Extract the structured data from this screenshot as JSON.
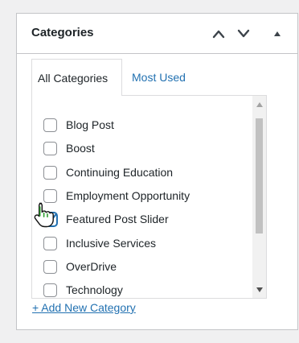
{
  "panel": {
    "title": "Categories",
    "move_up_icon": "chevron-up-icon",
    "move_down_icon": "chevron-down-icon",
    "toggle_icon": "triangle-up-icon"
  },
  "tabs": [
    {
      "label": "All Categories",
      "active": true
    },
    {
      "label": "Most Used",
      "active": false
    }
  ],
  "categories": [
    {
      "label": "Blog Post",
      "checked": false
    },
    {
      "label": "Boost",
      "checked": false
    },
    {
      "label": "Continuing Education",
      "checked": false
    },
    {
      "label": "Employment Opportunity",
      "checked": false
    },
    {
      "label": "Featured Post Slider",
      "checked": true
    },
    {
      "label": "Inclusive Services",
      "checked": false
    },
    {
      "label": "OverDrive",
      "checked": false
    },
    {
      "label": "Technology",
      "checked": false
    }
  ],
  "add_new_label": "+ Add New Category",
  "colors": {
    "link": "#2271b1",
    "checkbox_checked": "#2271b1",
    "border": "#c3c4c7",
    "background": "#f0f0f1"
  }
}
